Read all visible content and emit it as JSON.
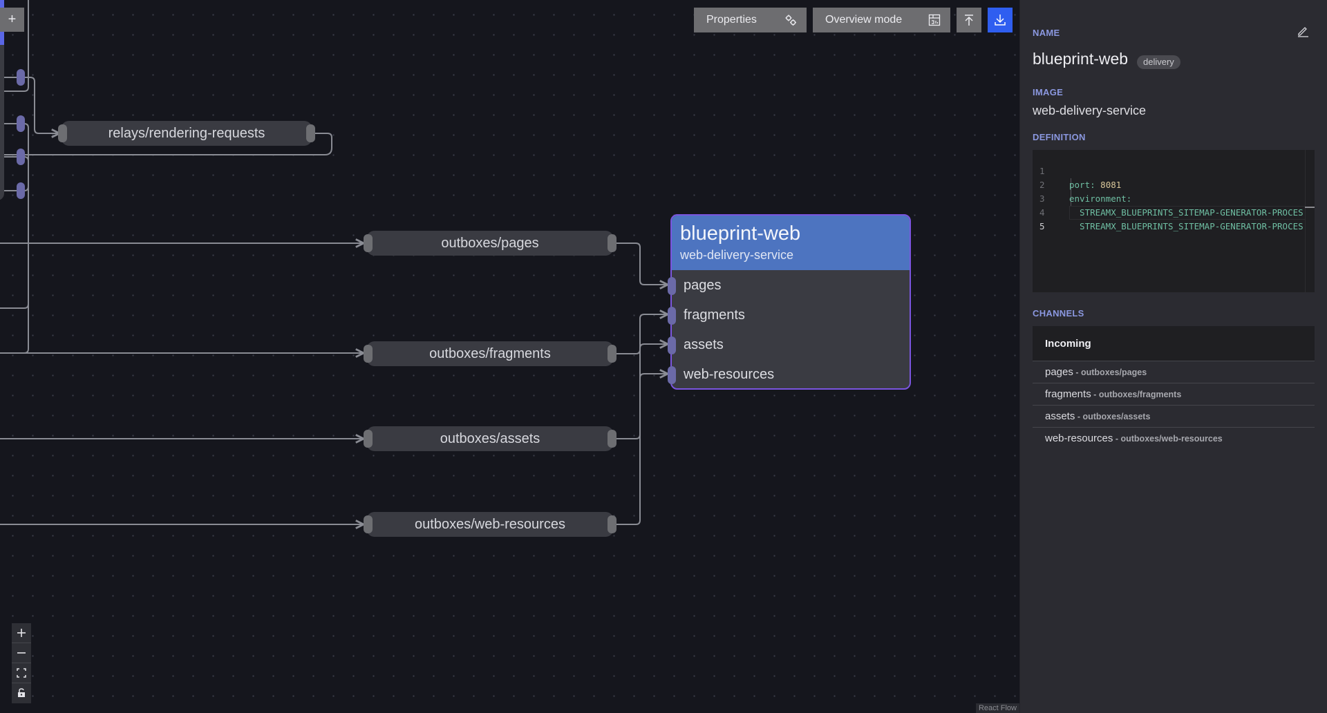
{
  "canvas": {
    "add_button": "+",
    "channel_nodes": [
      {
        "id": "relays",
        "label": "relays/rendering-requests"
      },
      {
        "id": "pages",
        "label": "outboxes/pages"
      },
      {
        "id": "fragments",
        "label": "outboxes/fragments"
      },
      {
        "id": "assets",
        "label": "outboxes/assets"
      },
      {
        "id": "web-resources",
        "label": "outboxes/web-resources"
      }
    ],
    "service_node": {
      "title": "blueprint-web",
      "subtitle": "web-delivery-service",
      "inputs": [
        "pages",
        "fragments",
        "assets",
        "web-resources"
      ]
    },
    "zoom_controls": {
      "zoom_in": "+",
      "zoom_out": "−",
      "fit": "fit-view",
      "lock": "lock"
    },
    "attribution": "React Flow"
  },
  "toolbar": {
    "properties_label": "Properties",
    "overview_label": "Overview mode",
    "properties_icon": "gears-icon",
    "overview_icon": "chart-table-icon",
    "upload_icon": "upload-icon",
    "download_icon": "download-icon",
    "primary_color": "#2f5ef0"
  },
  "panel": {
    "name_label": "NAME",
    "name": "blueprint-web",
    "tag": "delivery",
    "image_label": "IMAGE",
    "image": "web-delivery-service",
    "definition_label": "DEFINITION",
    "definition_lines": [
      {
        "n": "1",
        "key": "port",
        "sep": ": ",
        "val": "8081"
      },
      {
        "n": "2",
        "key": "environment",
        "sep": ":",
        "val": ""
      },
      {
        "n": "3",
        "key": "  STREAMX_BLUEPRINTS_SITEMAP-GENERATOR-PROCES",
        "sep": "",
        "val": ""
      },
      {
        "n": "4",
        "key": "  STREAMX_BLUEPRINTS_SITEMAP-GENERATOR-PROCES",
        "sep": "",
        "val": ""
      },
      {
        "n": "5",
        "key": "",
        "sep": "",
        "val": ""
      }
    ],
    "channels_label": "CHANNELS",
    "incoming_label": "Incoming",
    "incoming": [
      {
        "name": "pages",
        "source": "outboxes/pages"
      },
      {
        "name": "fragments",
        "source": "outboxes/fragments"
      },
      {
        "name": "assets",
        "source": "outboxes/assets"
      },
      {
        "name": "web-resources",
        "source": "outboxes/web-resources"
      }
    ]
  }
}
